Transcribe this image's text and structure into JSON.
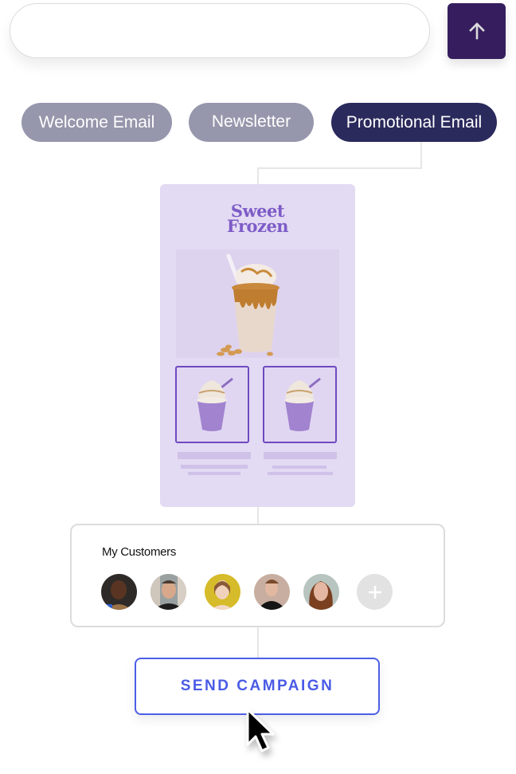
{
  "prompt": {
    "input_value": "",
    "input_placeholder": "",
    "submit_icon": "arrow-up-icon",
    "submit_color": "#361e5e"
  },
  "templates": [
    {
      "label": "Welcome Email",
      "active": false
    },
    {
      "label": "Newsletter",
      "active": false
    },
    {
      "label": "Promotional Email",
      "active": true
    }
  ],
  "email_preview": {
    "brand_line1": "Sweet",
    "brand_line2": "Frozen",
    "hero_image": "caramel-milkshake-image",
    "products": [
      {
        "image": "purple-frappe-image"
      },
      {
        "image": "purple-frappe-image"
      }
    ],
    "background_color": "#e3daf3",
    "accent_color": "#7d5cc7"
  },
  "customers": {
    "title": "My Customers",
    "avatars": [
      {
        "name": "customer-avatar-1"
      },
      {
        "name": "customer-avatar-2"
      },
      {
        "name": "customer-avatar-3"
      },
      {
        "name": "customer-avatar-4"
      },
      {
        "name": "customer-avatar-5"
      }
    ],
    "add_icon": "plus-icon"
  },
  "send_campaign": {
    "label": "SEND CAMPAIGN",
    "color": "#4d5ee8"
  }
}
